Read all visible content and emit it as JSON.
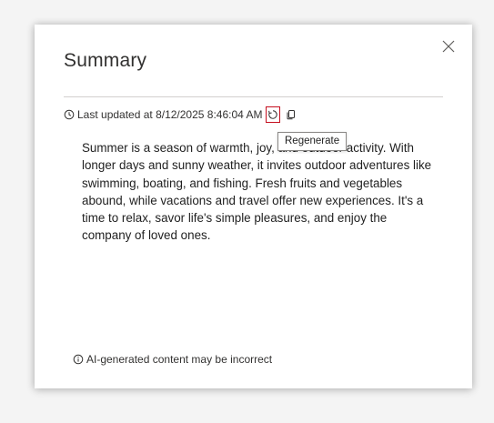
{
  "dialog": {
    "title": "Summary",
    "close_icon": "close-icon",
    "last_updated": "Last updated at 8/12/2025 8:46:04 AM",
    "regenerate_tooltip": "Regenerate",
    "regenerate_icon": "refresh-icon",
    "copy_icon": "copy-icon",
    "clock_icon": "clock-icon",
    "summary_text": "Summer is a season of warmth, joy, and outdoor activity. With longer days and sunny weather, it invites outdoor adventures like swimming, boating, and fishing. Fresh fruits and vegetables abound, while vacations and travel offer new experiences. It's a time to relax, savor life's simple pleasures, and enjoy the company of loved ones.",
    "footer_note": "AI-generated content may be incorrect",
    "info_icon": "info-icon"
  },
  "colors": {
    "focus_border": "#c50f1f",
    "divider": "#d2d0ce",
    "tooltip_border": "#8a8886"
  }
}
